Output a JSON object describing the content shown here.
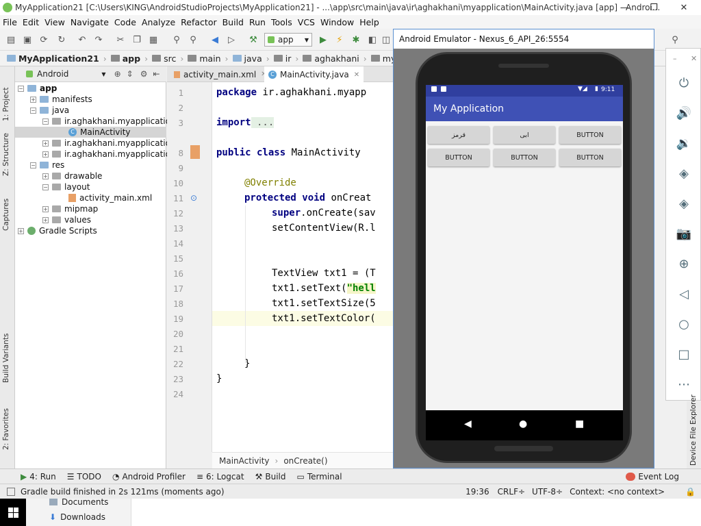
{
  "window": {
    "title": "MyApplication21 [C:\\Users\\KING\\AndroidStudioProjects\\MyApplication21] - ...\\app\\src\\main\\java\\ir\\aghakhani\\myapplication\\MainActivity.java [app] - Androi...",
    "min": "—",
    "max": "❐",
    "close": "✕"
  },
  "menu": [
    "File",
    "Edit",
    "View",
    "Navigate",
    "Code",
    "Analyze",
    "Refactor",
    "Build",
    "Run",
    "Tools",
    "VCS",
    "Window",
    "Help"
  ],
  "toolbar": {
    "run_config": "app"
  },
  "breadcrumbs": [
    "MyApplication21",
    "app",
    "src",
    "main",
    "java",
    "ir",
    "aghakhani",
    "myapplication"
  ],
  "project_panel": {
    "mode": "Android"
  },
  "left_tools": [
    "1: Project",
    "Z: Structure",
    "Captures",
    "Build Variants",
    "2: Favorites"
  ],
  "tree": [
    {
      "label": "app",
      "indent": 0,
      "icon": "folder",
      "toggle": "−",
      "bold": true
    },
    {
      "label": "manifests",
      "indent": 1,
      "icon": "folder",
      "toggle": "+"
    },
    {
      "label": "java",
      "indent": 1,
      "icon": "folder",
      "toggle": "−"
    },
    {
      "label": "ir.aghakhani.myapplication",
      "indent": 2,
      "icon": "package",
      "toggle": "−"
    },
    {
      "label": "MainActivity",
      "indent": 3,
      "icon": "class",
      "toggle": "",
      "selected": true
    },
    {
      "label": "ir.aghakhani.myapplication",
      "indent": 2,
      "icon": "package",
      "toggle": "+"
    },
    {
      "label": "ir.aghakhani.myapplication",
      "indent": 2,
      "icon": "package",
      "toggle": "+"
    },
    {
      "label": "res",
      "indent": 1,
      "icon": "folder",
      "toggle": "−"
    },
    {
      "label": "drawable",
      "indent": 2,
      "icon": "folder",
      "toggle": "+"
    },
    {
      "label": "layout",
      "indent": 2,
      "icon": "folder",
      "toggle": "−"
    },
    {
      "label": "activity_main.xml",
      "indent": 3,
      "icon": "xml",
      "toggle": ""
    },
    {
      "label": "mipmap",
      "indent": 2,
      "icon": "folder",
      "toggle": "+"
    },
    {
      "label": "values",
      "indent": 2,
      "icon": "folder",
      "toggle": "+"
    },
    {
      "label": "Gradle Scripts",
      "indent": 0,
      "icon": "gradle",
      "toggle": "+"
    }
  ],
  "tabs": [
    "activity_main.xml",
    "MainActivity.java"
  ],
  "line_numbers": [
    "1",
    "2",
    "3",
    "8",
    "9",
    "10",
    "11",
    "12",
    "13",
    "14",
    "15",
    "16",
    "17",
    "18",
    "19",
    "20",
    "21",
    "22",
    "23",
    "24"
  ],
  "code": {
    "l1_kw": "package",
    "l1_rest": " ir.aghakhani.myapp",
    "l3_kw": "import",
    "l3_rest": " ...",
    "l8_kw": "public class",
    "l8_rest": " MainActivity",
    "l10": "@Override",
    "l11_kw": "protected void",
    "l11_rest": " onCreat",
    "l12_kw": "super",
    "l12_rest": ".onCreate(sav",
    "l13": "setContentView(R.l",
    "l16": "TextView txt1 = (T",
    "l17_a": "txt1.setText(",
    "l17_s": "\"hell",
    "l18": "txt1.setTextSize(5",
    "l19": "txt1.setTextColor(",
    "l22": "}",
    "l23": "}"
  },
  "editor_crumbs": [
    "MainActivity",
    "onCreate()"
  ],
  "emulator": {
    "title": "Android Emulator - Nexus_6_API_26:5554",
    "time": "9:11",
    "app_title": "My Application",
    "buttons_row1": [
      "قرمز",
      "ابی",
      "BUTTON"
    ],
    "buttons_row2": [
      "BUTTON",
      "BUTTON",
      "BUTTON"
    ]
  },
  "right_tool": "Device File Explorer",
  "bottom_tools": [
    "4: Run",
    "TODO",
    "Android Profiler",
    "6: Logcat",
    "Build",
    "Terminal"
  ],
  "event_log": "Event Log",
  "status": {
    "message": "Gradle build finished in 2s 121ms (moments ago)",
    "position": "19:36",
    "line_sep": "CRLF÷",
    "encoding": "UTF-8÷",
    "context": "Context: <no context>"
  },
  "taskbar": {
    "items": [
      "Documents",
      "Downloads"
    ]
  }
}
